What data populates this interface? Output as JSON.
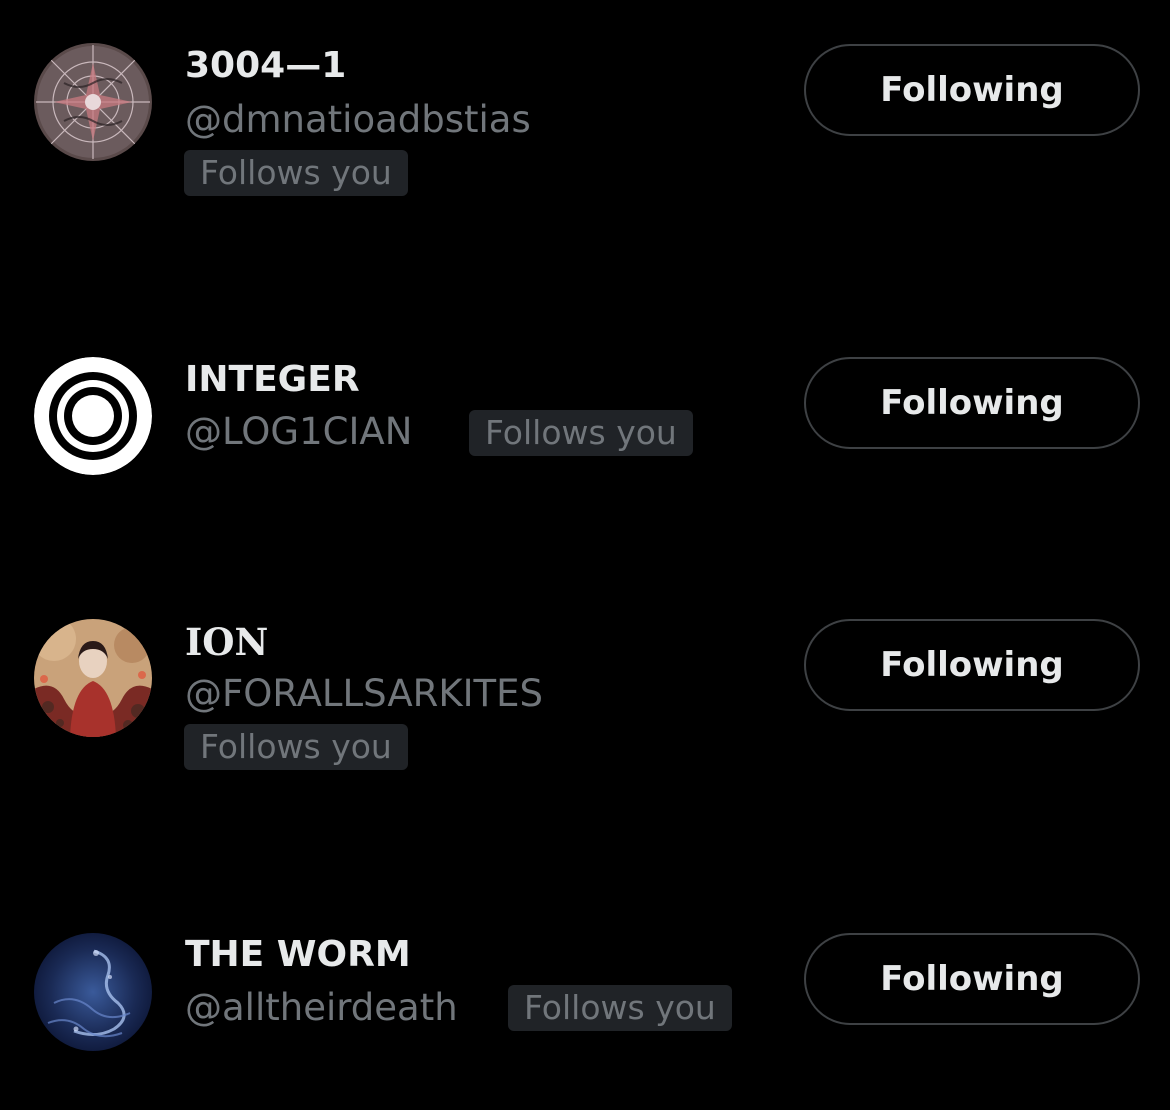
{
  "users": [
    {
      "display_name": "3004—1",
      "handle": "@dmnatioadbstias",
      "follows_you_label": "Follows you",
      "button_label": "Following",
      "avatar_icon": "sigil-avatar-icon"
    },
    {
      "display_name": "INTEGER",
      "handle": "@LOG1CIAN",
      "follows_you_label": "Follows you",
      "button_label": "Following",
      "avatar_icon": "concentric-circles-avatar-icon"
    },
    {
      "display_name": "ION",
      "handle": "@FORALLSARKITES",
      "follows_you_label": "Follows you",
      "button_label": "Following",
      "avatar_icon": "illustrated-figure-avatar-icon"
    },
    {
      "display_name": "THE WORM",
      "handle": "@alltheirdeath",
      "follows_you_label": "Follows you",
      "button_label": "Following",
      "avatar_icon": "blue-wave-avatar-icon"
    }
  ],
  "colors": {
    "background": "#000000",
    "primary_text": "#e7e9ea",
    "secondary_text": "#71767b",
    "badge_background": "#202327",
    "button_border": "#3e4144"
  }
}
